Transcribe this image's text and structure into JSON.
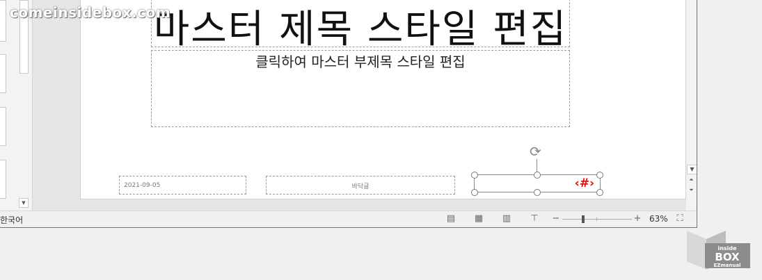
{
  "watermark": "comeinsidebox.com",
  "slide": {
    "title": "마스터 제목 스타일 편집",
    "subtitle": "클릭하여 마스터 부제목 스타일 편집",
    "date": "2021-09-05",
    "footer": "바닥글",
    "slide_number": "‹#›"
  },
  "status_bar": {
    "language": "한국어",
    "zoom_minus": "−",
    "zoom_plus": "+",
    "zoom_percent": "63%",
    "zoom_level": 0.63
  },
  "logo": {
    "line1": "inside",
    "line2": "BOX",
    "line3": "EZmanual"
  },
  "colors": {
    "accent_border": "#c0504d",
    "slide_number": "#e01010"
  }
}
